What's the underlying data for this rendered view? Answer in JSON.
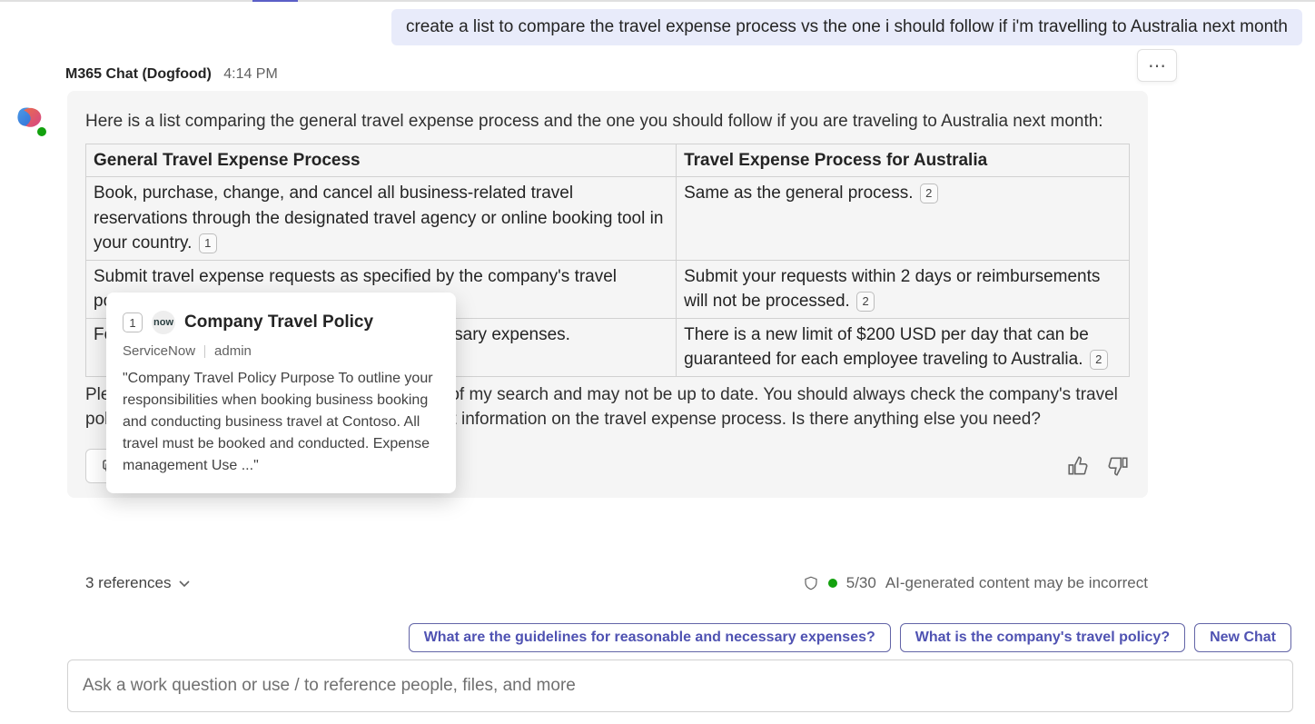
{
  "user_msg": "create a list to compare the travel expense process vs the one i should follow if i'm travelling to Australia next month",
  "sender": {
    "name": "M365 Chat (Dogfood)",
    "time": "4:14 PM"
  },
  "intro": "Here is a list comparing the general travel expense process and the one you should follow if you are traveling to Australia next month:",
  "table": {
    "headers": {
      "col1": "General Travel Expense Process",
      "col2": "Travel Expense Process for Australia"
    },
    "rows": [
      {
        "col1_a": "Book, purchase, change, and cancel all business-related travel reservations through the designated travel agency or online booking tool in your country.",
        "col1_badge": "1",
        "col2_a": "Same as the general process.",
        "col2_badge": "2"
      },
      {
        "col1_a": "Submit travel expense requests as specified by the company's travel policy.",
        "col2_a": "Submit your requests within 2 days or reimbursements will not be processed.",
        "col2_badge": "2"
      },
      {
        "col1_a": "Follow the guidelines for reasonable and necessary expenses.",
        "col2_a": "There is a new limit of $200 USD per day that can be guaranteed for each employee traveling to Australia.",
        "col2_badge": "2"
      }
    ]
  },
  "disclaimer": "Please note that this list is based on the results of my search and may not be up to date. You should always check the company's travel policy or finance department for the most current information on the travel expense process. Is there anything else you need?",
  "copy_label": "Copy",
  "references": {
    "label": "3 references"
  },
  "ai_note": {
    "count": "5/30",
    "text": "AI-generated content may be incorrect"
  },
  "suggestions": [
    "What are the guidelines for reasonable and necessary expenses?",
    "What is the company's travel policy?",
    "New Chat"
  ],
  "input_placeholder": "Ask a work question or use / to reference people, files, and more",
  "hover": {
    "num": "1",
    "logo_text": "now",
    "title": "Company Travel Policy",
    "source": "ServiceNow",
    "author": "admin",
    "body": "\"Company Travel Policy Purpose To outline your responsibilities when booking business booking and conducting business travel at Contoso. All travel must be booked and conducted. Expense management Use ...\""
  }
}
